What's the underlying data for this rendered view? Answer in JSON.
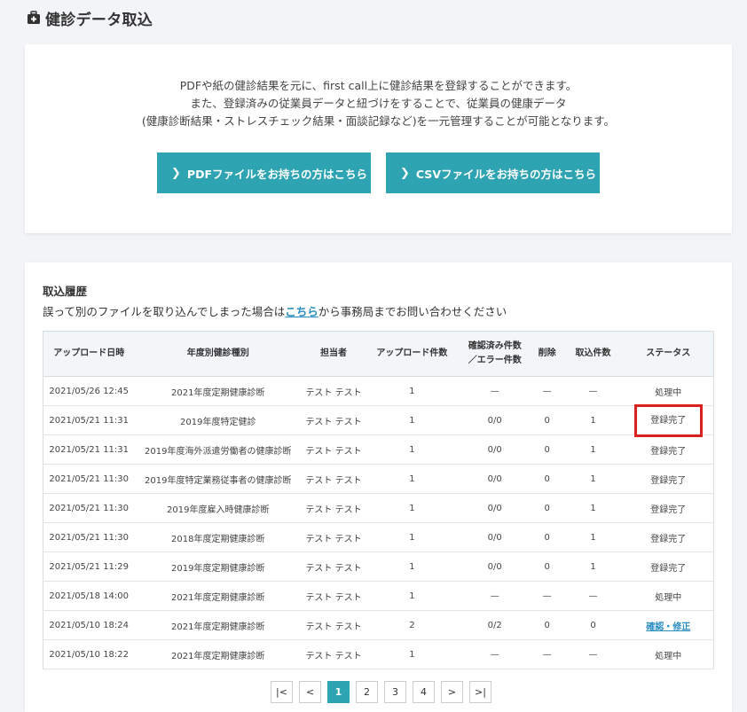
{
  "header": {
    "title": "健診データ取込",
    "icon": "medical-bag-icon"
  },
  "intro": {
    "line1": "PDFや紙の健診結果を元に、first call上に健診結果を登録することができます。",
    "line2": "また、登録済みの従業員データと紐づけをすることで、従業員の健康データ",
    "line3": "(健康診断結果・ストレスチェック結果・面談記録など)を一元管理することが可能となります。",
    "pdf_button": "PDFファイルをお持ちの方はこちら",
    "csv_button": "CSVファイルをお持ちの方はこちら",
    "accent_color": "#2ea3b2"
  },
  "history": {
    "title": "取込履歴",
    "note_before": "誤って別のファイルを取り込んでしまった場合は",
    "note_link": "こちら",
    "note_after": "から事務局までお問い合わせください",
    "columns": {
      "date": "アップロード日時",
      "type": "年度別健診種別",
      "person": "担当者",
      "uploads": "アップロード件数",
      "confirmed_line1": "確認済み件数",
      "confirmed_line2": "／エラー件数",
      "deleted": "削除",
      "imported": "取込件数",
      "status": "ステータス"
    },
    "rows": [
      [
        "2021/05/26 12:45",
        "2021年度定期健康診断",
        "テスト テスト",
        "1",
        "—",
        "—",
        "—",
        "処理中"
      ],
      [
        "2021/05/21 11:31",
        "2019年度特定健診",
        "テスト テスト",
        "1",
        "0/0",
        "0",
        "1",
        "登録完了"
      ],
      [
        "2021/05/21 11:31",
        "2019年度海外派遣労働者の健康診断",
        "テスト テスト",
        "1",
        "0/0",
        "0",
        "1",
        "登録完了"
      ],
      [
        "2021/05/21 11:30",
        "2019年度特定業務従事者の健康診断",
        "テスト テスト",
        "1",
        "0/0",
        "0",
        "1",
        "登録完了"
      ],
      [
        "2021/05/21 11:30",
        "2019年度雇入時健康診断",
        "テスト テスト",
        "1",
        "0/0",
        "0",
        "1",
        "登録完了"
      ],
      [
        "2021/05/21 11:30",
        "2018年度定期健康診断",
        "テスト テスト",
        "1",
        "0/0",
        "0",
        "1",
        "登録完了"
      ],
      [
        "2021/05/21 11:29",
        "2019年度定期健康診断",
        "テスト テスト",
        "1",
        "0/0",
        "0",
        "1",
        "登録完了"
      ],
      [
        "2021/05/18 14:00",
        "2021年度定期健康診断",
        "テスト テスト",
        "1",
        "—",
        "—",
        "—",
        "処理中"
      ],
      [
        "2021/05/10 18:24",
        "2021年度定期健康診断",
        "テスト テスト",
        "2",
        "0/2",
        "0",
        "0",
        "確認・修正"
      ],
      [
        "2021/05/10 18:22",
        "2021年度定期健康診断",
        "テスト テスト",
        "1",
        "—",
        "—",
        "—",
        "処理中"
      ]
    ],
    "highlighted_row_index": 1,
    "highlight_color": "#d9211e"
  },
  "pagination": {
    "first": "|<",
    "prev": "<",
    "pages": [
      "1",
      "2",
      "3",
      "4"
    ],
    "current": "1",
    "next": ">",
    "last": ">|"
  }
}
